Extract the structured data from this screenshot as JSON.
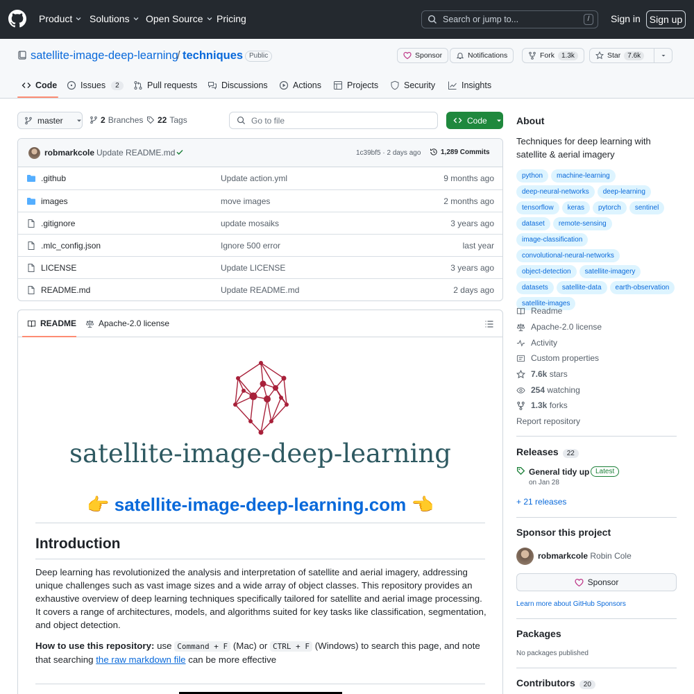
{
  "header": {
    "nav": [
      "Product",
      "Solutions",
      "Open Source",
      "Pricing"
    ],
    "search_placeholder": "Search or jump to...",
    "search_shortcut": "/",
    "signin": "Sign in",
    "signup": "Sign up"
  },
  "repo": {
    "owner": "satellite-image-deep-learning",
    "separator": "/",
    "name": "techniques",
    "visibility": "Public",
    "sponsor": "Sponsor",
    "notifications": "Notifications",
    "fork_label": "Fork",
    "fork_count": "1.3k",
    "star_label": "Star",
    "star_count": "7.6k"
  },
  "tabs": [
    {
      "label": "Code"
    },
    {
      "label": "Issues",
      "count": "2"
    },
    {
      "label": "Pull requests"
    },
    {
      "label": "Discussions"
    },
    {
      "label": "Actions"
    },
    {
      "label": "Projects"
    },
    {
      "label": "Security"
    },
    {
      "label": "Insights"
    }
  ],
  "branch": {
    "name": "master",
    "branches_count": "2",
    "branches_label": "Branches",
    "tags_count": "22",
    "tags_label": "Tags",
    "goto_placeholder": "Go to file",
    "code_button": "Code"
  },
  "latest_commit": {
    "author": "robmarkcole",
    "message": "Update README.md",
    "meta": "1c39bf5 · 2 days ago",
    "commits": "1,289 Commits"
  },
  "files": [
    {
      "type": "dir",
      "name": ".github",
      "message": "Update action.yml",
      "date": "9 months ago"
    },
    {
      "type": "dir",
      "name": "images",
      "message": "move images",
      "date": "2 months ago"
    },
    {
      "type": "file",
      "name": ".gitignore",
      "message": "update mosaiks",
      "date": "3 years ago"
    },
    {
      "type": "file",
      "name": ".mlc_config.json",
      "message": "Ignore 500 error",
      "date": "last year"
    },
    {
      "type": "file",
      "name": "LICENSE",
      "message": "Update LICENSE",
      "date": "3 years ago"
    },
    {
      "type": "file",
      "name": "README.md",
      "message": "Update README.md",
      "date": "2 days ago"
    }
  ],
  "readme": {
    "tab_readme": "README",
    "tab_license": "Apache-2.0 license",
    "logo_text": "satellite-image-deep-learning",
    "site_link": "satellite-image-deep-learning.com",
    "hand_emoji": "👉",
    "hand_emoji_back": "👈",
    "intro_heading": "Introduction",
    "intro_text": "Deep learning has revolutionized the analysis and interpretation of satellite and aerial imagery, addressing unique challenges such as vast image sizes and a wide array of object classes. This repository provides an exhaustive overview of deep learning techniques specifically tailored for satellite and aerial image processing. It covers a range of architectures, models, and algorithms suited for key tasks like classification, segmentation, and object detection.",
    "howto_label": "How to use this repository:",
    "howto_pre": "use",
    "howto_code1": "Command + F",
    "howto_mac": "(Mac) or",
    "howto_code2": "CTRL + F",
    "howto_win": "(Windows) to search this page, and note that searching",
    "howto_link": "the raw markdown file",
    "howto_end": "can be more effective"
  },
  "about": {
    "heading": "About",
    "description": "Techniques for deep learning with satellite & aerial imagery",
    "topics": [
      "python",
      "machine-learning",
      "deep-neural-networks",
      "deep-learning",
      "tensorflow",
      "keras",
      "pytorch",
      "sentinel",
      "dataset",
      "remote-sensing",
      "image-classification",
      "convolutional-neural-networks",
      "object-detection",
      "satellite-imagery",
      "datasets",
      "satellite-data",
      "earth-observation",
      "satellite-images"
    ],
    "readme": "Readme",
    "license": "Apache-2.0 license",
    "activity": "Activity",
    "custom_properties": "Custom properties",
    "stars_count": "7.6k",
    "stars_label": "stars",
    "watching_count": "254",
    "watching_label": "watching",
    "forks_count": "1.3k",
    "forks_label": "forks",
    "report": "Report repository"
  },
  "releases": {
    "heading": "Releases",
    "count": "22",
    "latest_title": "General tidy up",
    "latest_badge": "Latest",
    "latest_date": "on Jan 28",
    "more": "+ 21 releases"
  },
  "sponsor": {
    "heading": "Sponsor this project",
    "user": "robmarkcole",
    "fullname": "Robin Cole",
    "button": "Sponsor",
    "learn": "Learn more about GitHub Sponsors"
  },
  "packages": {
    "heading": "Packages",
    "none": "No packages published"
  },
  "contributors": {
    "heading": "Contributors",
    "count": "20"
  },
  "colors": {
    "header_bg": "#24292f",
    "link": "#0969da",
    "green": "#1f883d",
    "tab_underline": "#fd8c73",
    "logo_red": "#a8213a",
    "logo_teal": "#2e5961"
  }
}
